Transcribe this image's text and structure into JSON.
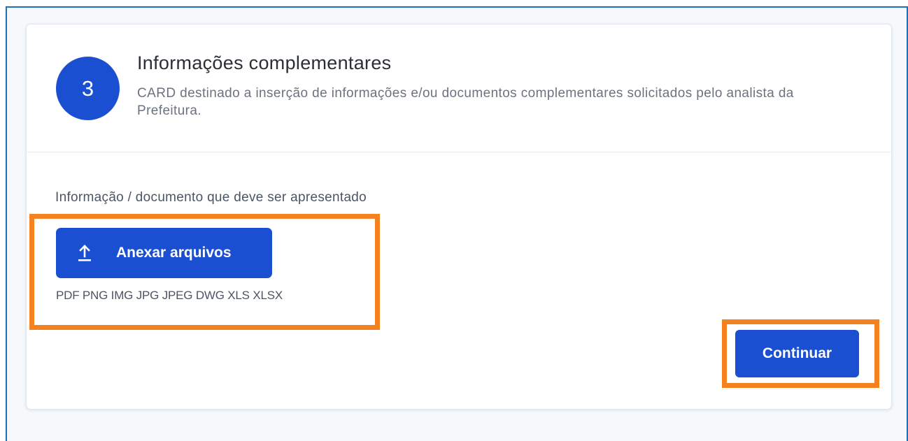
{
  "card": {
    "step_number": "3",
    "title": "Informações complementares",
    "description": "CARD destinado a inserção de informações e/ou documentos complementares solicitados pelo analista da Prefeitura."
  },
  "section": {
    "label": "Informação / documento que deve ser apresentado"
  },
  "upload": {
    "button_label": "Anexar arquivos",
    "icon": "upload-icon",
    "accepted_formats": "PDF PNG IMG JPG JPEG DWG XLS XLSX"
  },
  "actions": {
    "continue_label": "Continuar"
  },
  "colors": {
    "primary": "#1a4fd1",
    "highlight": "#f58220",
    "frame_border": "#1f6fb8"
  }
}
